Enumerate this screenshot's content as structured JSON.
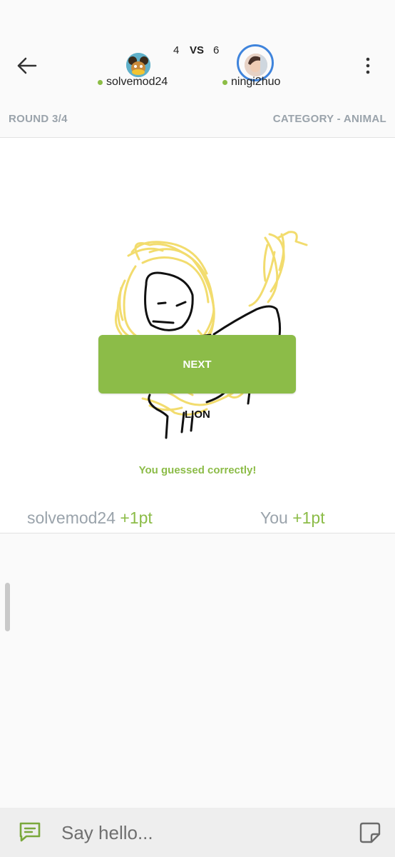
{
  "header": {
    "score_left": "4",
    "vs_label": "VS",
    "score_right": "6",
    "player_left": "solvemod24",
    "player_right": "ningi2huo",
    "back_icon": "arrow-left-icon",
    "menu_icon": "more-vertical-icon"
  },
  "round_bar": {
    "round": "ROUND 3/4",
    "category": "CATEGORY - ANIMAL"
  },
  "game": {
    "next_label": "NEXT",
    "answer": "LION",
    "result_message": "You guessed correctly!"
  },
  "points": {
    "left_name": "solvemod24",
    "left_points": "+1pt",
    "right_name": "You",
    "right_points": "+1pt"
  },
  "chat": {
    "placeholder": "Say hello...",
    "chat_icon": "chat-bubble-icon",
    "sticker_icon": "sticker-icon"
  },
  "colors": {
    "accent_green": "#8cbc48",
    "highlight_ring": "#3f84dc",
    "muted_text": "#9aa3ab",
    "drawing_yellow": "#f2dc6e"
  }
}
